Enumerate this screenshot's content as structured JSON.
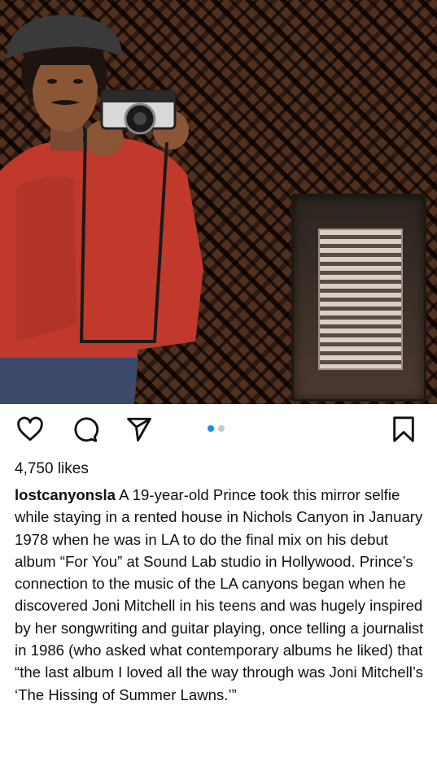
{
  "post": {
    "image_alt": "Mirror selfie in front of a woven-pattern wall with a metal vent",
    "carousel": {
      "total": 2,
      "active_index": 0
    },
    "likes_text": "4,750 likes",
    "username": "lostcanyonsla",
    "caption": "A 19-year-old Prince took this mirror selfie while staying in a rented house in Nichols Canyon in January 1978 when he was in LA to do the final mix on his debut album “For You” at Sound Lab studio in Hollywood. Prince’s connection to the music of the LA canyons began when he discovered Joni Mitchell in his teens and was hugely inspired by her songwriting and guitar playing, once telling a journalist in 1986 (who asked what contemporary albums he liked) that “the last album I loved all the way through was Joni Mitchell’s ‘The Hissing of Summer Lawns.’”"
  },
  "icons": {
    "like": "heart-icon",
    "comment": "comment-icon",
    "share": "paper-plane-icon",
    "save": "bookmark-icon"
  },
  "colors": {
    "text": "#111111",
    "carousel_active": "#1a8fe3",
    "carousel_inactive": "#c8c8c8"
  }
}
